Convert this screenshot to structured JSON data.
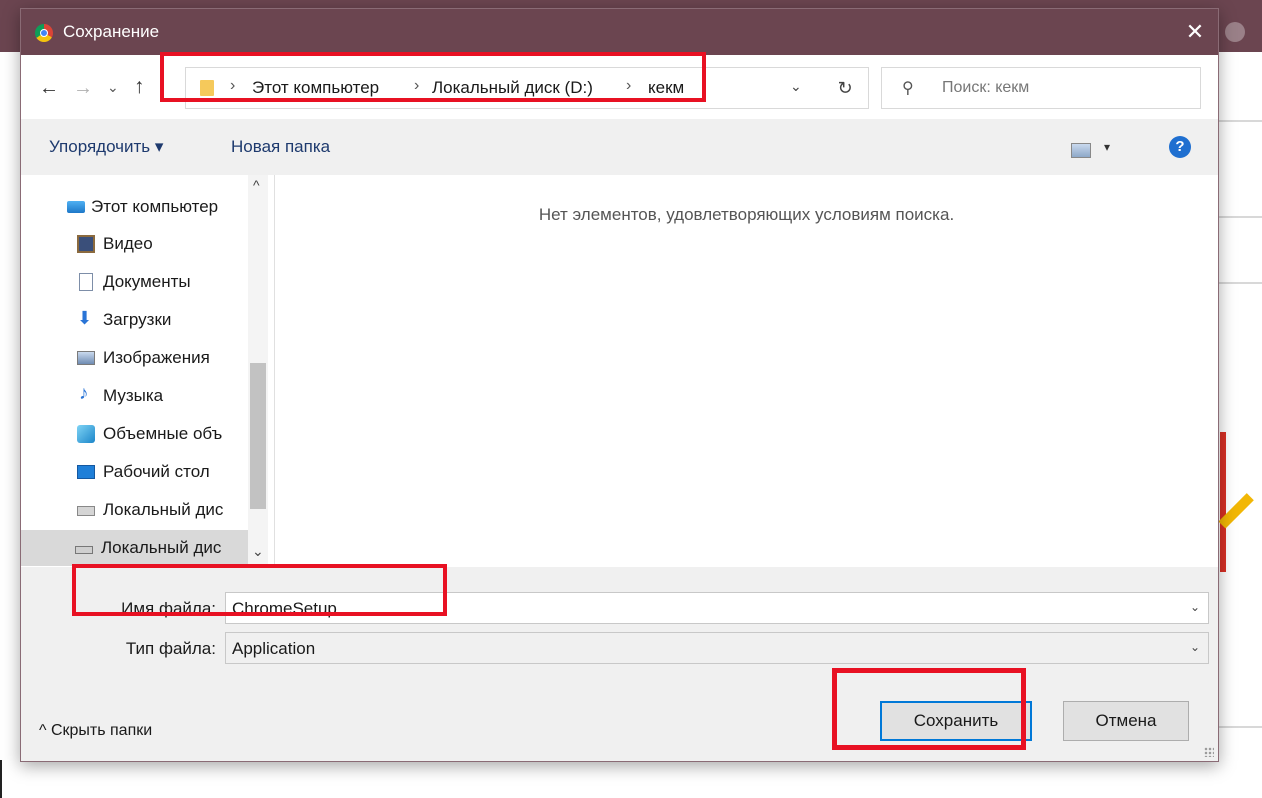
{
  "dialog": {
    "title": "Сохранение",
    "close_glyph": "✕"
  },
  "nav": {
    "back_glyph": "←",
    "forward_glyph": "→",
    "recent_glyph": "⌄",
    "up_glyph": "↑",
    "breadcrumb": [
      "Этот компьютер",
      "Локальный диск (D:)",
      "кекм"
    ],
    "separator_glyph": "›",
    "dropdown_glyph": "⌄",
    "refresh_glyph": "↻",
    "search_placeholder": "Поиск: кекм",
    "search_glyph": "⚲"
  },
  "toolbar": {
    "organize_label": "Упорядочить ▾",
    "new_folder_label": "Новая папка",
    "view_caret": "▾",
    "help_glyph": "?"
  },
  "sidebar": {
    "items": [
      {
        "label": "Этот компьютер",
        "icon": "computer-icon"
      },
      {
        "label": "Видео",
        "icon": "video-icon"
      },
      {
        "label": "Документы",
        "icon": "documents-icon"
      },
      {
        "label": "Загрузки",
        "icon": "downloads-icon"
      },
      {
        "label": "Изображения",
        "icon": "pictures-icon"
      },
      {
        "label": "Музыка",
        "icon": "music-icon"
      },
      {
        "label": "Объемные объ",
        "icon": "3d-objects-icon"
      },
      {
        "label": "Рабочий стол",
        "icon": "desktop-icon"
      },
      {
        "label": "Локальный дис",
        "icon": "local-disk-c-icon"
      },
      {
        "label": "Локальный дис",
        "icon": "local-disk-d-icon",
        "selected": true
      }
    ],
    "scroll_up_glyph": "^",
    "scroll_down_glyph": "⌄"
  },
  "content": {
    "empty_message": "Нет элементов, удовлетворяющих условиям поиска."
  },
  "form": {
    "filename_label": "Имя файла:",
    "filename_value": "ChromeSetup",
    "filetype_label": "Тип файла:",
    "filetype_value": "Application",
    "dropdown_glyph": "⌄"
  },
  "footer": {
    "hide_folders_label": "^ Скрыть папки",
    "save_label": "Сохранить",
    "cancel_label": "Отмена"
  },
  "colors": {
    "titlebar": "#6b4550",
    "highlight": "#e81123",
    "accent": "#0078d7"
  }
}
